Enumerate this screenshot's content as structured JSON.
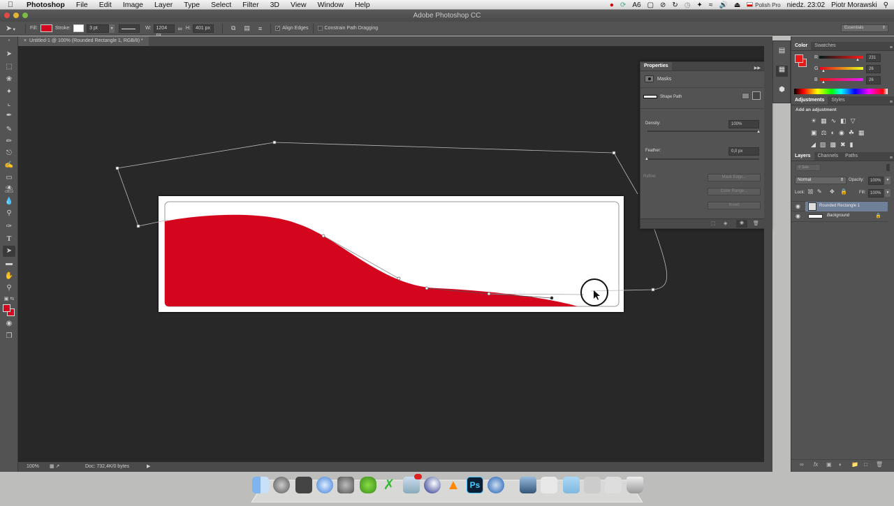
{
  "menubar": {
    "app_name": "Photoshop",
    "items": [
      "File",
      "Edit",
      "Image",
      "Layer",
      "Type",
      "Select",
      "Filter",
      "3D",
      "View",
      "Window",
      "Help"
    ],
    "status": {
      "adobe_count": "6",
      "input_source": "Polish Pro",
      "clock": "niedz. 23:02",
      "user": "Piotr Morawski"
    }
  },
  "window": {
    "title": "Adobe Photoshop CC"
  },
  "options_bar": {
    "fill_label": "Fill:",
    "fill_color": "#d4061e",
    "stroke_label": "Stroke:",
    "stroke_width": "3 pt",
    "w_label": "W:",
    "w_value": "1204 px",
    "h_label": "H:",
    "h_value": "401 px",
    "align_edges_label": "Align Edges",
    "align_edges_checked": true,
    "constrain_label": "Constrain Path Dragging",
    "constrain_checked": false,
    "workspace": "Essentials"
  },
  "document": {
    "tab_title": "Untitled-1 @ 100% (Rounded Rectangle 1, RGB/8) *",
    "shape_color": "#d4061e"
  },
  "statusbar": {
    "zoom": "100%",
    "doc_info": "Doc: 732,4K/0 bytes"
  },
  "properties": {
    "title": "Properties",
    "section": "Masks",
    "shape_path_label": "Shape Path",
    "density_label": "Density:",
    "density_value": "100%",
    "density_fraction": 1.0,
    "feather_label": "Feather:",
    "feather_value": "0,0 px",
    "feather_fraction": 0.0,
    "refine_label": "Refine:",
    "buttons": [
      "Mask Edge...",
      "Color Range...",
      "Invert"
    ]
  },
  "color_panel": {
    "tabs": [
      "Color",
      "Swatches"
    ],
    "channels": [
      {
        "name": "R",
        "value": "231"
      },
      {
        "name": "G",
        "value": "26"
      },
      {
        "name": "B",
        "value": "26"
      }
    ],
    "foreground": "#e71a1a"
  },
  "adjustments_panel": {
    "tabs": [
      "Adjustments",
      "Styles"
    ],
    "heading": "Add an adjustment"
  },
  "layers_panel": {
    "tabs": [
      "Layers",
      "Channels",
      "Paths"
    ],
    "filter_placeholder": "Sele",
    "blend_mode": "Normal",
    "opacity_label": "Opacity:",
    "opacity_value": "100%",
    "lock_label": "Lock:",
    "fill_label": "Fill:",
    "fill_value": "100%",
    "layers": [
      {
        "name": "Rounded Rectangle 1",
        "selected": true,
        "visible": true
      },
      {
        "name": "Background",
        "selected": false,
        "visible": true,
        "locked": true
      }
    ]
  },
  "dock": {
    "apps": [
      "Finder",
      "Launchpad",
      "Dashboard",
      "Safari",
      "System Preferences",
      "Adium",
      "Xmarks",
      "Mail",
      "Cinema 4D",
      "VLC",
      "Photoshop",
      "QuickTime",
      "Preview",
      "Keyboard",
      "Folder",
      "Downloads",
      "Documents",
      "Trash"
    ]
  }
}
